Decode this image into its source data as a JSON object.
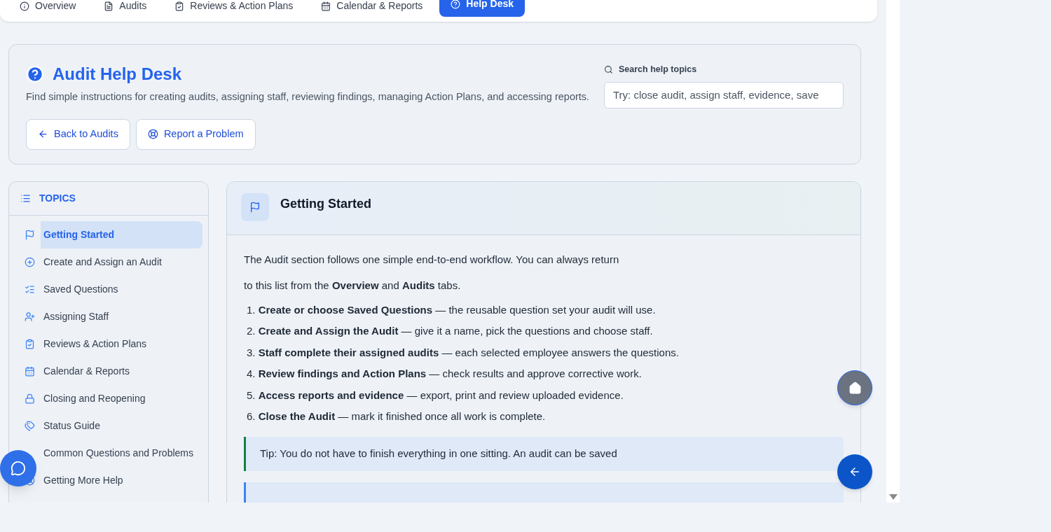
{
  "nav_tabs": [
    {
      "label": "Overview",
      "selected": false
    },
    {
      "label": "Audits",
      "selected": false
    },
    {
      "label": "Reviews & Action Plans",
      "selected": false
    },
    {
      "label": "Calendar & Reports",
      "selected": false
    },
    {
      "label": "Help Desk",
      "selected": true
    }
  ],
  "header": {
    "title": "Audit Help Desk",
    "description": "Find simple instructions for creating audits, assigning staff, reviewing findings, managing Action Plans, and accessing reports.",
    "buttons": [
      {
        "label": "Back to Audits"
      },
      {
        "label": "Report a Problem"
      }
    ],
    "search": {
      "label": "Search help topics",
      "placeholder": "Try: close audit, assign staff, evidence, save"
    }
  },
  "topics": {
    "title": "TOPICS",
    "items": [
      {
        "label": "Getting Started",
        "selected": true
      },
      {
        "label": "Create and Assign an Audit",
        "selected": false
      },
      {
        "label": "Saved Questions",
        "selected": false
      },
      {
        "label": "Assigning Staff",
        "selected": false
      },
      {
        "label": "Reviews & Action Plans",
        "selected": false
      },
      {
        "label": "Calendar & Reports",
        "selected": false
      },
      {
        "label": "Closing and Reopening",
        "selected": false
      },
      {
        "label": "Status Guide",
        "selected": false
      },
      {
        "label": "Common Questions and Problems",
        "selected": false
      },
      {
        "label": "Getting More Help",
        "selected": false
      }
    ]
  },
  "article": {
    "title": "Getting Started",
    "intro": [
      "The Audit section follows one simple end-to-end workflow. You can always return",
      "to this list from the **Overview** and **Audits** tabs."
    ],
    "steps": [
      "1. **Create or choose Saved Questions** — the reusable question set your audit will use.",
      "2. **Create and Assign the Audit** — give it a name, pick the questions and choose staff.",
      "3. **Staff complete their assigned audits** — each selected employee answers the questions.",
      "4. **Review findings and Action Plans** — check results and approve corrective work.",
      "5. **Access reports and evidence** — export, print and review uploaded evidence.",
      "6. **Close the Audit** — mark it finished once all work is complete."
    ],
    "tips": [
      {
        "kind": "success",
        "text": "Tip: You do not have to finish everything in one sitting. An audit can be saved"
      },
      {
        "kind": "info"
      }
    ]
  }
}
